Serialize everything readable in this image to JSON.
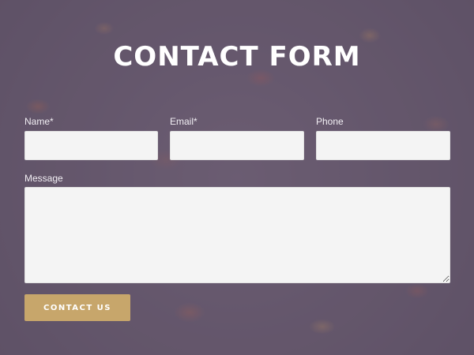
{
  "form": {
    "title": "CONTACT FORM",
    "name_label": "Name*",
    "name_value": "",
    "email_label": "Email*",
    "email_value": "",
    "phone_label": "Phone",
    "phone_value": "",
    "message_label": "Message",
    "message_value": "",
    "submit_label": "CONTACT US"
  },
  "colors": {
    "accent": "#c7a66b",
    "overlay": "#5f4e69",
    "field_background": "#f4f4f4",
    "title": "#ffffff"
  }
}
